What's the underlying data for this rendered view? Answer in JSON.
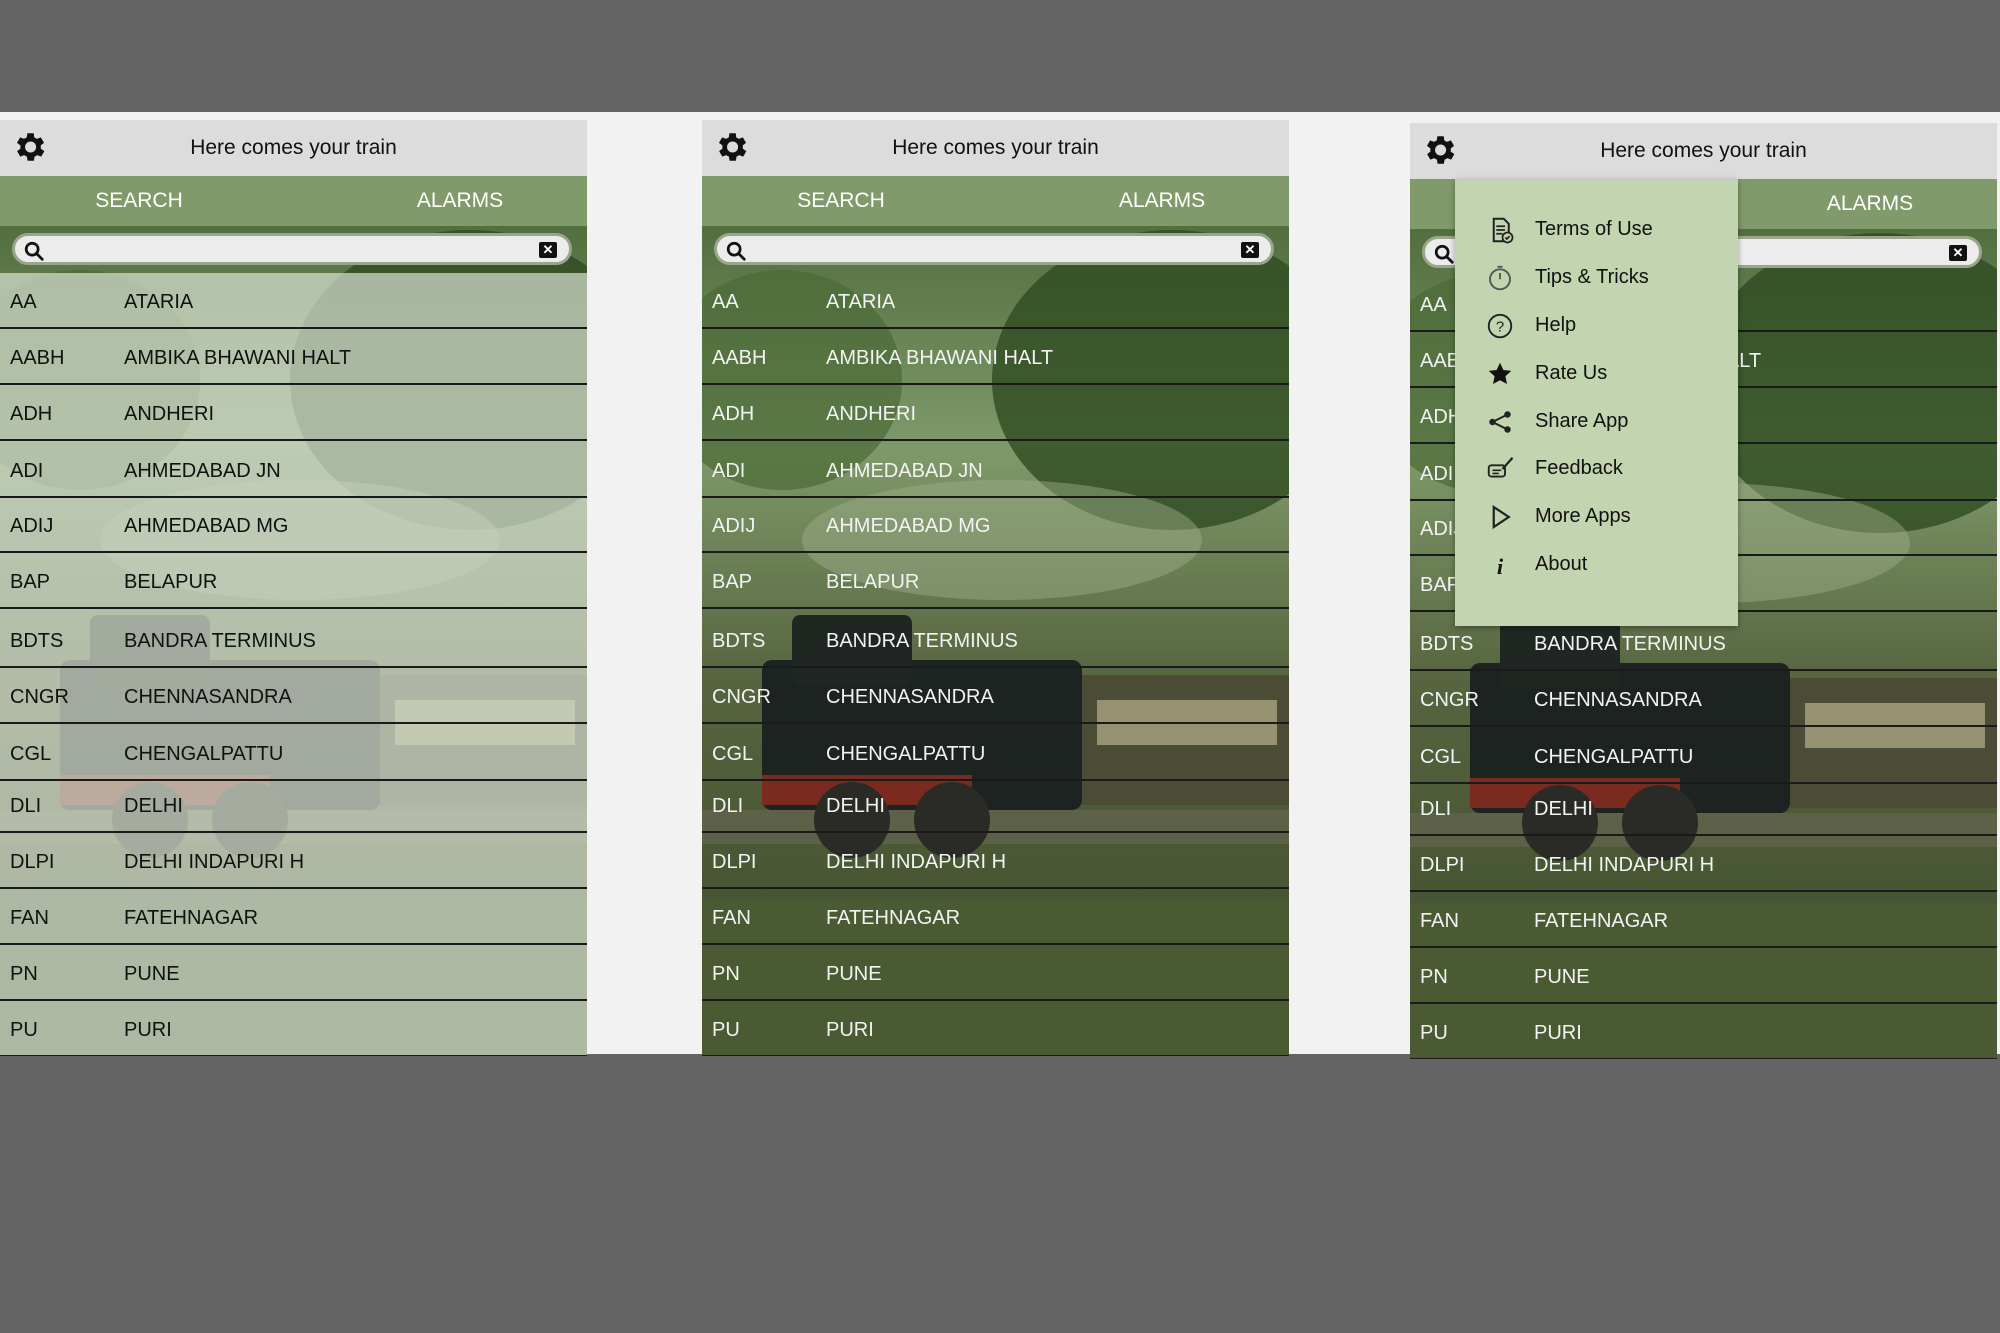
{
  "app": {
    "title": "Here comes your train",
    "tabs": [
      "SEARCH",
      "ALARMS"
    ],
    "search_placeholder": ""
  },
  "stations": [
    {
      "code": "AA",
      "name": "ATARIA"
    },
    {
      "code": "AABH",
      "name": "AMBIKA BHAWANI HALT"
    },
    {
      "code": "ADH",
      "name": "ANDHERI"
    },
    {
      "code": "ADI",
      "name": "AHMEDABAD JN"
    },
    {
      "code": "ADIJ",
      "name": "AHMEDABAD  MG"
    },
    {
      "code": "BAP",
      "name": "BELAPUR"
    },
    {
      "code": "BDTS",
      "name": "BANDRA TERMINUS"
    },
    {
      "code": "CNGR",
      "name": "CHENNASANDRA"
    },
    {
      "code": "CGL",
      "name": "CHENGALPATTU"
    },
    {
      "code": "DLI",
      "name": "DELHI"
    },
    {
      "code": "DLPI",
      "name": "DELHI INDAPURI H"
    },
    {
      "code": "FAN",
      "name": "FATEHNAGAR"
    },
    {
      "code": "PN",
      "name": "PUNE"
    },
    {
      "code": "PU",
      "name": "PURI"
    }
  ],
  "menu": {
    "items": [
      {
        "label": "Terms of Use",
        "icon": "document-icon"
      },
      {
        "label": "Tips & Tricks",
        "icon": "stopwatch-icon"
      },
      {
        "label": "Help",
        "icon": "question-icon"
      },
      {
        "label": "Rate Us",
        "icon": "star-icon"
      },
      {
        "label": "Share App",
        "icon": "share-icon"
      },
      {
        "label": "Feedback",
        "icon": "feedback-icon"
      },
      {
        "label": "More Apps",
        "icon": "play-icon"
      },
      {
        "label": "About",
        "icon": "info-icon"
      }
    ]
  },
  "colors": {
    "page_bg": "#646464",
    "strip_bg": "#f2f2f2",
    "topbar": "#dcdcdc",
    "tabbar": "#819a6b",
    "menu_bg": "#c2d4b0"
  }
}
